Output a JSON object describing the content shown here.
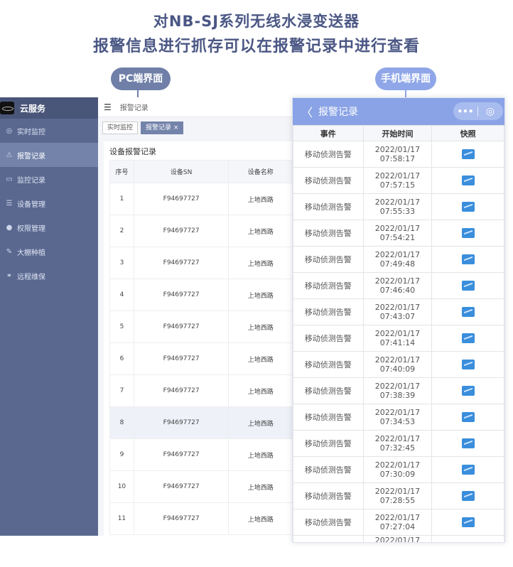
{
  "headline": {
    "line1": "对NB-SJ系列无线水浸变送器",
    "line2": "报警信息进行抓存可以在报警记录中进行查看"
  },
  "labels": {
    "pc": "PC端界面",
    "mobile": "手机端界面"
  },
  "pc": {
    "brand": "云服务",
    "nav": [
      {
        "icon": "camera-icon",
        "label": "实时监控",
        "active": false
      },
      {
        "icon": "alert-icon",
        "label": "报警记录",
        "active": true
      },
      {
        "icon": "video-icon",
        "label": "监控记录",
        "active": false
      },
      {
        "icon": "list-icon",
        "label": "设备管理",
        "active": false
      },
      {
        "icon": "permission-icon",
        "label": "权限管理",
        "active": false
      },
      {
        "icon": "plant-icon",
        "label": "大棚种植",
        "active": false
      },
      {
        "icon": "link-icon",
        "label": "远程维保",
        "active": false
      }
    ],
    "breadcrumb": "报警记录",
    "tabs": [
      "实时监控",
      "报警记录 ×"
    ],
    "card_title": "设备报警记录",
    "columns": [
      "序号",
      "设备SN",
      "设备名称"
    ],
    "rows": [
      [
        "1",
        "F94697727",
        "上地西路"
      ],
      [
        "2",
        "F94697727",
        "上地西路"
      ],
      [
        "3",
        "F94697727",
        "上地西路"
      ],
      [
        "4",
        "F94697727",
        "上地西路"
      ],
      [
        "5",
        "F94697727",
        "上地西路"
      ],
      [
        "6",
        "F94697727",
        "上地西路"
      ],
      [
        "7",
        "F94697727",
        "上地西路"
      ],
      [
        "8",
        "F94697727",
        "上地西路"
      ],
      [
        "9",
        "F94697727",
        "上地西路"
      ],
      [
        "10",
        "F94697727",
        "上地西路"
      ],
      [
        "11",
        "F94697727",
        "上地西路"
      ]
    ]
  },
  "mobile": {
    "title": "报警记录",
    "columns": [
      "事件",
      "开始时间",
      "快照"
    ],
    "rows": [
      {
        "event": "移动侦测告警",
        "date": "2022/01/17",
        "time": "07:58:17"
      },
      {
        "event": "移动侦测告警",
        "date": "2022/01/17",
        "time": "07:57:15"
      },
      {
        "event": "移动侦测告警",
        "date": "2022/01/17",
        "time": "07:55:33"
      },
      {
        "event": "移动侦测告警",
        "date": "2022/01/17",
        "time": "07:54:21"
      },
      {
        "event": "移动侦测告警",
        "date": "2022/01/17",
        "time": "07:49:48"
      },
      {
        "event": "移动侦测告警",
        "date": "2022/01/17",
        "time": "07:46:40"
      },
      {
        "event": "移动侦测告警",
        "date": "2022/01/17",
        "time": "07:43:07"
      },
      {
        "event": "移动侦测告警",
        "date": "2022/01/17",
        "time": "07:41:14"
      },
      {
        "event": "移动侦测告警",
        "date": "2022/01/17",
        "time": "07:40:09"
      },
      {
        "event": "移动侦测告警",
        "date": "2022/01/17",
        "time": "07:38:39"
      },
      {
        "event": "移动侦测告警",
        "date": "2022/01/17",
        "time": "07:34:53"
      },
      {
        "event": "移动侦测告警",
        "date": "2022/01/17",
        "time": "07:32:45"
      },
      {
        "event": "移动侦测告警",
        "date": "2022/01/17",
        "time": "07:30:09"
      },
      {
        "event": "移动侦测告警",
        "date": "2022/01/17",
        "time": "07:28:55"
      },
      {
        "event": "移动侦测告警",
        "date": "2022/01/17",
        "time": "07:27:04"
      }
    ],
    "partial_date": "2022/01/17"
  }
}
